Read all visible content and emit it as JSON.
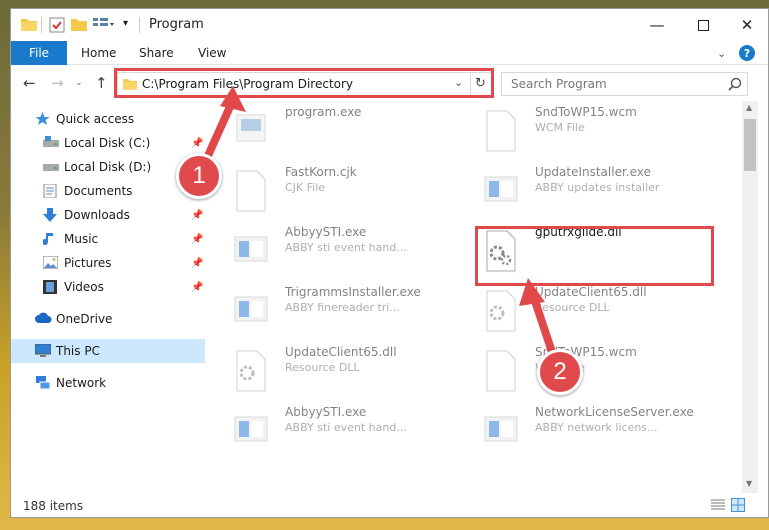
{
  "window": {
    "title": "Program"
  },
  "ribbon": {
    "file": "File",
    "tabs": [
      "Home",
      "Share",
      "View"
    ]
  },
  "address": {
    "path": "C:\\Program Files\\Program Directory"
  },
  "search": {
    "placeholder": "Search Program"
  },
  "sidebar": {
    "items": [
      {
        "label": "Quick access"
      },
      {
        "label": "Local Disk (C:)"
      },
      {
        "label": "Local Disk (D:)"
      },
      {
        "label": "Documents"
      },
      {
        "label": "Downloads"
      },
      {
        "label": "Music"
      },
      {
        "label": "Pictures"
      },
      {
        "label": "Videos"
      },
      {
        "label": "OneDrive"
      },
      {
        "label": "This PC"
      },
      {
        "label": "Network"
      }
    ]
  },
  "files": [
    {
      "name": "program.exe",
      "type": ""
    },
    {
      "name": "SndToWP15.wcm",
      "type": "WCM File"
    },
    {
      "name": "FastKorn.cjk",
      "type": "CJK File"
    },
    {
      "name": "UpdateInstaller.exe",
      "type": "ABBY updates installer"
    },
    {
      "name": "AbbyySTI.exe",
      "type": "ABBY sti event hand..."
    },
    {
      "name": "gputrxglide.dll",
      "type": ""
    },
    {
      "name": "TrigrammsInstaller.exe",
      "type": "ABBY finereader tri..."
    },
    {
      "name": "UpdateClient65.dll",
      "type": "Resource DLL"
    },
    {
      "name": "UpdateClient65.dll",
      "type": "Resource DLL"
    },
    {
      "name": "SndToWP15.wcm",
      "type": "WCM File"
    },
    {
      "name": "AbbyySTI.exe",
      "type": "ABBY sti event hand..."
    },
    {
      "name": "NetworkLicenseServer.exe",
      "type": "ABBY network licens..."
    }
  ],
  "status": {
    "items": "188 items"
  },
  "callouts": {
    "one": "1",
    "two": "2"
  },
  "colors": {
    "accent": "#1979ca",
    "highlight": "#e0484a",
    "selected": "#cce8ff"
  }
}
